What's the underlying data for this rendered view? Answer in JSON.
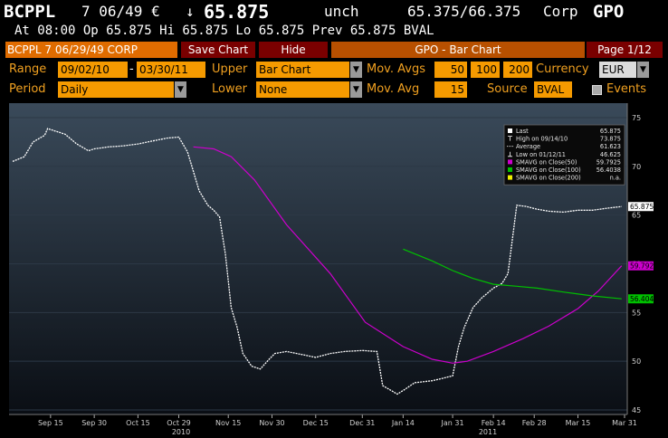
{
  "header": {
    "ticker": "BCPPL",
    "coupon_maturity": "7 06/49 €",
    "arrow": "↓",
    "price": "65.875",
    "change": "unch",
    "bid_ask": "65.375/66.375",
    "market": "Corp",
    "function": "GPO",
    "line2": "At 08:00   Op 65.875   Hi 65.875   Lo 65.875   Prev 65.875   BVAL"
  },
  "toolbar": {
    "security": "BCPPL 7 06/29/49 CORP",
    "save_label": "Save Chart",
    "hide_label": "Hide",
    "title": "GPO - Bar Chart",
    "page": "Page 1/12"
  },
  "params": {
    "range_label": "Range",
    "range_from": "09/02/10",
    "range_sep": "-",
    "range_to": "03/30/11",
    "upper_label": "Upper",
    "upper_value": "Bar Chart",
    "mov_avgs_label": "Mov. Avgs",
    "mov_avgs": [
      "50",
      "100",
      "200"
    ],
    "currency_label": "Currency",
    "currency_value": "EUR",
    "period_label": "Period",
    "period_value": "Daily",
    "lower_label": "Lower",
    "lower_value": "None",
    "mov_avg_label": "Mov. Avg",
    "mov_avg_value": "15",
    "source_label": "Source",
    "source_value": "BVAL",
    "events_label": "Events"
  },
  "colors": {
    "price": "#ffffff",
    "sma50": "#cc00cc",
    "sma100": "#00c000",
    "sma200": "#f0f000",
    "accent": "#f59a00"
  },
  "chart_data": {
    "type": "line",
    "ylim": [
      45,
      75
    ],
    "yticks": [
      "75",
      "70",
      "65",
      "60",
      "55",
      "50",
      "45"
    ],
    "xticks": [
      "Sep 15",
      "Sep 30",
      "Oct 15",
      "Oct 29",
      "Nov 15",
      "Nov 30",
      "Dec 15",
      "Dec 31",
      "Jan 14",
      "Jan 31",
      "Feb 14",
      "Feb 28",
      "Mar 15",
      "Mar 31"
    ],
    "year_labels": [
      "2010",
      "2011"
    ],
    "legend": [
      {
        "marker": "Last",
        "label": "Last",
        "value": "65.875"
      },
      {
        "marker": "High",
        "label": "High on 09/14/10",
        "value": "73.875"
      },
      {
        "marker": "Average",
        "label": "Average",
        "value": "61.623"
      },
      {
        "marker": "Low",
        "label": "Low on 01/12/11",
        "value": "46.625"
      },
      {
        "marker": "SMA50",
        "label": "SMAVG on Close(50)",
        "value": "59.7925"
      },
      {
        "marker": "SMA100",
        "label": "SMAVG on Close(100)",
        "value": "56.4038"
      },
      {
        "marker": "SMA200",
        "label": "SMAVG on Close(200)",
        "value": "n.a."
      }
    ],
    "tags": [
      {
        "value": "65.875",
        "series": "price"
      },
      {
        "value": "59.792",
        "series": "sma50"
      },
      {
        "value": "56.404",
        "series": "sma100"
      }
    ],
    "series": [
      {
        "name": "Last",
        "x": [
          "2010-09-02",
          "2010-09-06",
          "2010-09-09",
          "2010-09-13",
          "2010-09-14",
          "2010-09-20",
          "2010-09-24",
          "2010-09-28",
          "2010-09-30",
          "2010-10-05",
          "2010-10-10",
          "2010-10-15",
          "2010-10-20",
          "2010-10-25",
          "2010-10-29",
          "2010-11-01",
          "2010-11-03",
          "2010-11-05",
          "2010-11-08",
          "2010-11-10",
          "2010-11-12",
          "2010-11-14",
          "2010-11-16",
          "2010-11-18",
          "2010-11-20",
          "2010-11-23",
          "2010-11-26",
          "2010-11-29",
          "2010-12-01",
          "2010-12-05",
          "2010-12-10",
          "2010-12-15",
          "2010-12-20",
          "2010-12-25",
          "2010-12-31",
          "2011-01-05",
          "2011-01-07",
          "2011-01-12",
          "2011-01-14",
          "2011-01-18",
          "2011-01-24",
          "2011-01-27",
          "2011-01-31",
          "2011-02-02",
          "2011-02-04",
          "2011-02-07",
          "2011-02-10",
          "2011-02-14",
          "2011-02-17",
          "2011-02-19",
          "2011-02-22",
          "2011-02-25",
          "2011-03-01",
          "2011-03-05",
          "2011-03-10",
          "2011-03-15",
          "2011-03-20",
          "2011-03-25",
          "2011-03-30"
        ],
        "y": [
          70.5,
          71.0,
          72.5,
          73.2,
          73.875,
          73.3,
          72.3,
          71.6,
          71.8,
          72.0,
          72.1,
          72.3,
          72.6,
          72.9,
          73.0,
          71.5,
          69.5,
          67.5,
          66.0,
          65.5,
          64.8,
          61.0,
          55.5,
          53.5,
          50.8,
          49.5,
          49.2,
          50.2,
          50.8,
          51.0,
          50.7,
          50.4,
          50.8,
          51.0,
          51.1,
          51.0,
          47.5,
          46.625,
          47.0,
          47.8,
          48.0,
          48.2,
          48.5,
          51.5,
          53.5,
          55.5,
          56.5,
          57.5,
          58.0,
          59.0,
          66.0,
          65.9,
          65.6,
          65.4,
          65.3,
          65.5,
          65.5,
          65.7,
          65.875
        ]
      },
      {
        "name": "SMAVG on Close(50)",
        "x": [
          "2010-11-03",
          "2010-11-10",
          "2010-11-16",
          "2010-11-24",
          "2010-12-05",
          "2010-12-20",
          "2011-01-01",
          "2011-01-14",
          "2011-01-24",
          "2011-01-31",
          "2011-02-05",
          "2011-02-14",
          "2011-02-24",
          "2011-03-05",
          "2011-03-15",
          "2011-03-22",
          "2011-03-30"
        ],
        "y": [
          72.0,
          71.8,
          71.0,
          68.6,
          64.0,
          59.0,
          54.0,
          51.5,
          50.2,
          49.8,
          50.0,
          51.0,
          52.3,
          53.6,
          55.4,
          57.2,
          59.7925
        ]
      },
      {
        "name": "SMAVG on Close(100)",
        "x": [
          "2011-01-14",
          "2011-01-24",
          "2011-01-31",
          "2011-02-07",
          "2011-02-14",
          "2011-02-22",
          "2011-03-01",
          "2011-03-10",
          "2011-03-20",
          "2011-03-30"
        ],
        "y": [
          61.5,
          60.3,
          59.3,
          58.5,
          57.9,
          57.7,
          57.5,
          57.1,
          56.7,
          56.4038
        ]
      }
    ]
  }
}
